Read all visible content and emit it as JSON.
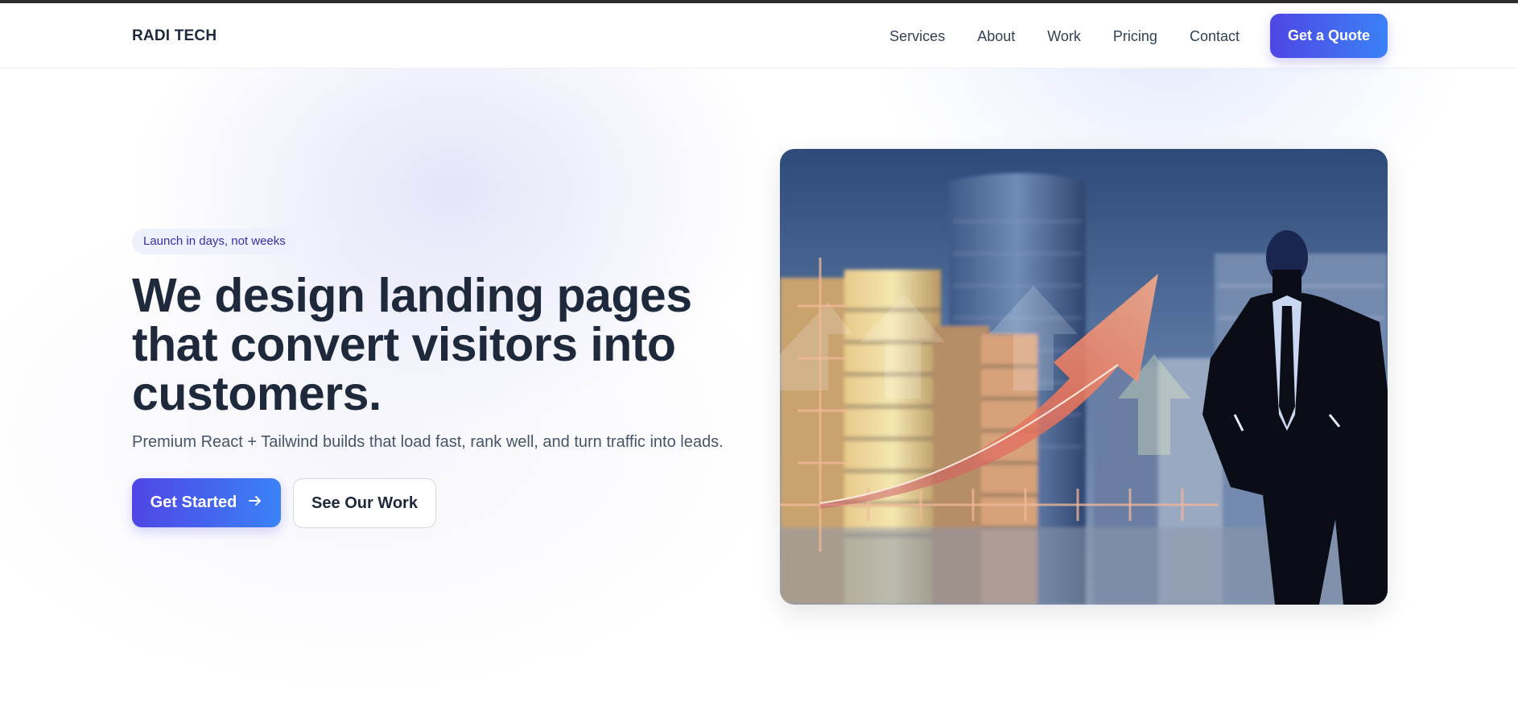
{
  "header": {
    "brand": "RADI TECH",
    "nav": [
      "Services",
      "About",
      "Work",
      "Pricing",
      "Contact"
    ],
    "cta_label": "Get a Quote"
  },
  "hero": {
    "badge": "Launch in days, not weeks",
    "title": "We design landing pages that convert visitors into customers.",
    "subtitle": "Premium React + Tailwind builds that load fast, rank well, and turn traffic into leads.",
    "primary_label": "Get Started",
    "primary_icon": "arrow-right-icon",
    "secondary_label": "See Our Work"
  },
  "colors": {
    "accent_start": "#4f46e5",
    "accent_end": "#3b82f6",
    "text_dark": "#1e293b",
    "badge_bg": "#eef0fb"
  }
}
